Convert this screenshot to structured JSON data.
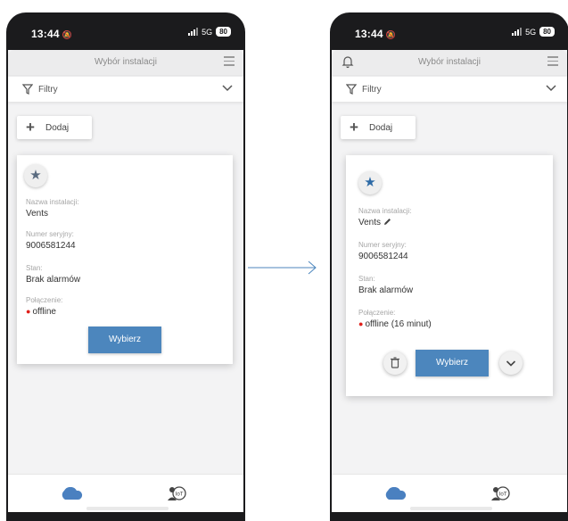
{
  "left": {
    "status": {
      "time": "13:44",
      "network": "5G",
      "battery": "80"
    },
    "appbar": {
      "title": "Wybór instalacji"
    },
    "filters": {
      "label": "Filtry"
    },
    "add": {
      "label": "Dodaj"
    },
    "card": {
      "name_label": "Nazwa instalacji:",
      "name_value": "Vents",
      "serial_label": "Numer seryjny:",
      "serial_value": "9006581244",
      "state_label": "Stan:",
      "state_value": "Brak alarmów",
      "connection_label": "Połączenie:",
      "connection_value": "offline",
      "select_label": "Wybierz"
    }
  },
  "right": {
    "status": {
      "time": "13:44",
      "network": "5G",
      "battery": "80"
    },
    "appbar": {
      "title": "Wybór instalacji"
    },
    "filters": {
      "label": "Filtry"
    },
    "add": {
      "label": "Dodaj"
    },
    "card": {
      "name_label": "Nazwa instalacji:",
      "name_value": "Vents",
      "serial_label": "Numer seryjny:",
      "serial_value": "9006581244",
      "state_label": "Stan:",
      "state_value": "Brak alarmów",
      "connection_label": "Połączenie:",
      "connection_value": "offline (16 minut)",
      "select_label": "Wybierz"
    }
  },
  "colors": {
    "accent": "#4c86bd",
    "star_active": "#2d6aa6",
    "offline_dot": "#e0201b",
    "cloud": "#4a80c0",
    "arrow": "#4c86bd"
  }
}
